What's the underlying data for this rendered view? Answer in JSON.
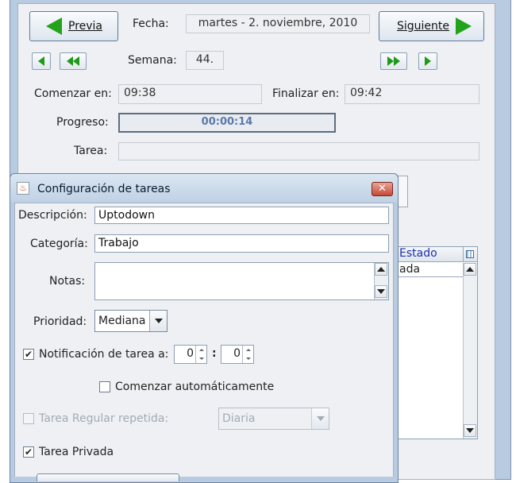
{
  "main": {
    "prev_label": "Previa",
    "next_label": "Siguiente",
    "date_label": "Fecha:",
    "date_value": "martes - 2. noviembre, 2010",
    "week_label": "Semana:",
    "week_value": "44.",
    "start_label": "Comenzar en:",
    "start_value": "09:38",
    "end_label": "Finalizar en:",
    "end_value": "09:42",
    "progress_label": "Progreso:",
    "progress_value": "00:00:14",
    "task_label": "Tarea:",
    "task_value": "",
    "list_header": "Estado",
    "list_row_partial": "ada"
  },
  "dialog": {
    "title": "Configuración de tareas",
    "description_label": "Descripción:",
    "description_value": "Uptodown",
    "category_label": "Categoría:",
    "category_value": "Trabajo",
    "notes_label": "Notas:",
    "notes_value": "",
    "priority_label": "Prioridad:",
    "priority_value": "Mediana",
    "notification_label": "Notificación de tarea a:",
    "notification_checked": true,
    "notify_hours": "0",
    "notify_separator": ":",
    "notify_minutes": "0",
    "auto_start_label": "Comenzar automáticamente",
    "auto_start_checked": false,
    "regular_label": "Tarea Regular repetida:",
    "regular_checked": false,
    "regular_value": "Diaria",
    "private_label": "Tarea Privada",
    "private_checked": true
  },
  "colors": {
    "accent_green": "#22a319",
    "frame_blue": "#b9cbe0",
    "progress_text": "#5b79a8",
    "header_text": "#1a2fb0"
  }
}
